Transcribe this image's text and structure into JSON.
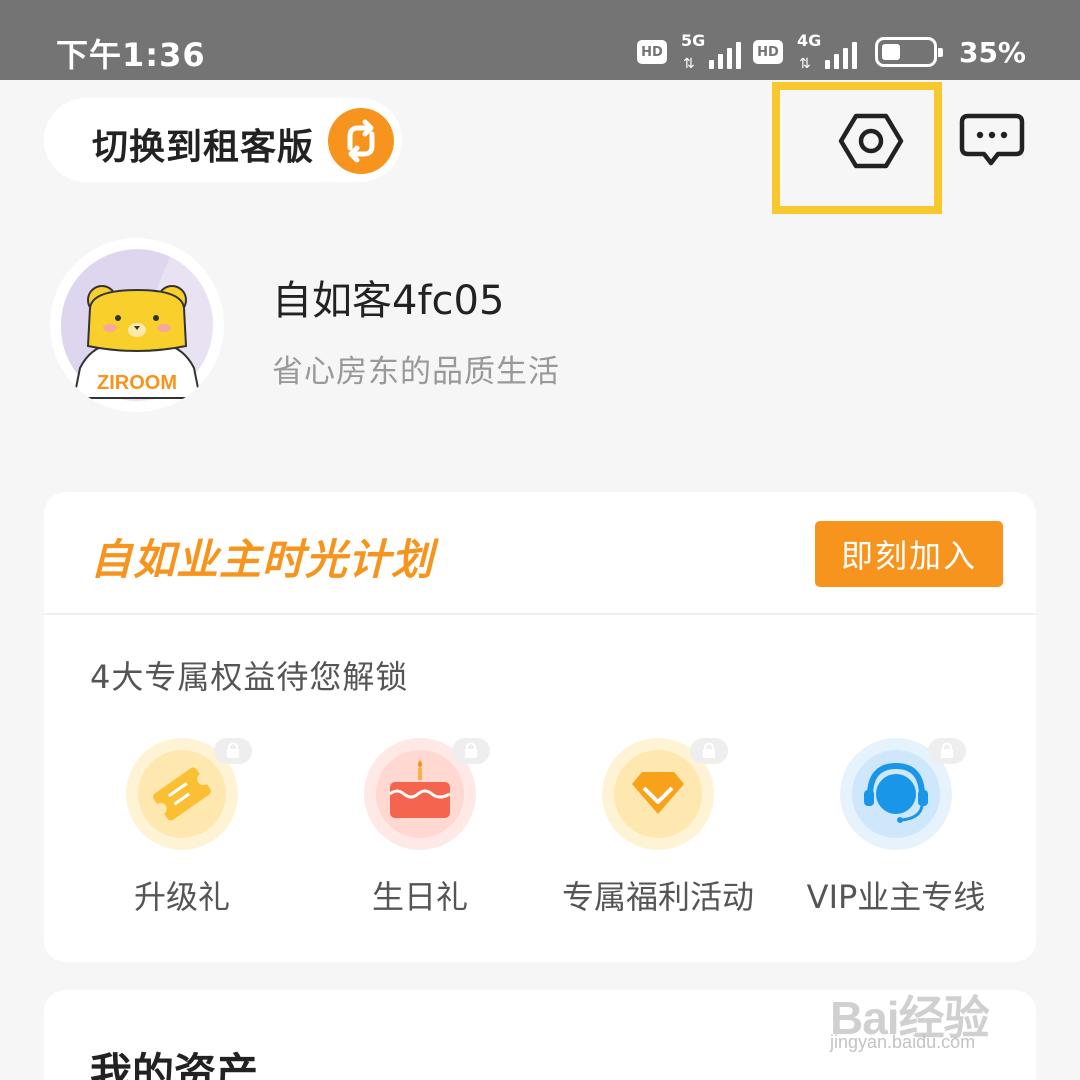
{
  "status_bar": {
    "time": "下午1:36",
    "hd_badge": "HD",
    "network_1": "5G",
    "network_2": "4G",
    "battery_level": 0.35,
    "battery_text": "35%"
  },
  "top_bar": {
    "switch_label": "切换到租客版",
    "switch_icon": "swap-arrows-icon",
    "settings_icon": "hexagon-settings-icon",
    "message_icon": "chat-bubble-icon",
    "highlight_color": "#f8c92f"
  },
  "profile": {
    "avatar_icon": "bear-mascot-icon",
    "avatar_text": "ZIROOM",
    "username": "自如客4fc05",
    "slogan": "省心房东的品质生活"
  },
  "plan": {
    "title": "自如业主时光计划",
    "join_label": "即刻加入",
    "subtitle": "4大专属权益待您解锁",
    "accent_color": "#f7941d",
    "benefits": [
      {
        "label": "升级礼",
        "icon": "ticket-icon",
        "locked": true
      },
      {
        "label": "生日礼",
        "icon": "cake-icon",
        "locked": true
      },
      {
        "label": "专属福利活动",
        "icon": "diamond-icon",
        "locked": true
      },
      {
        "label": "VIP业主专线",
        "icon": "headset-icon",
        "locked": true
      }
    ]
  },
  "assets": {
    "title": "我的资产"
  },
  "watermark": {
    "logo": "Bai经验",
    "url": "jingyan.baidu.com"
  }
}
